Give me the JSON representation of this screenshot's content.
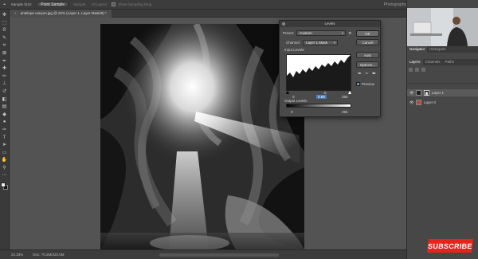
{
  "options_bar": {
    "sample_size_label": "Sample Size:",
    "sample_size_value": "Point Sample",
    "sample_label": "Sample:",
    "sample_value": "All Layers",
    "show_ring_label": "Show Sampling Ring",
    "workspace": "Photography"
  },
  "document_tab": {
    "title": "antelope canyon.jpg @ 22% (Layer 1, Layer Mask/8) *",
    "close": "×"
  },
  "status_bar": {
    "zoom": "22.33%",
    "doc": "Doc: 70.2M/220.0M"
  },
  "levels_dialog": {
    "title": "Levels",
    "preset_label": "Preset:",
    "preset_value": "Custom",
    "channel_label": "Channel:",
    "channel_value": "Layer 1 Mask",
    "input_label": "Input Levels:",
    "input_black": "0",
    "input_mid": "0.69",
    "input_white": "255",
    "output_label": "Output Levels:",
    "output_black": "0",
    "output_white": "255",
    "ok": "OK",
    "cancel": "Cancel",
    "auto": "Auto",
    "options": "Options...",
    "preview": "Preview"
  },
  "right_panel": {
    "tabs_top": [
      "Navigator",
      "Histogram"
    ],
    "tabs_layers": [
      "Layers",
      "Channels",
      "Paths"
    ],
    "layers": [
      {
        "name": "Layer 1",
        "selected": true
      },
      {
        "name": "Layer 0",
        "selected": false
      }
    ]
  },
  "subscribe": "SUBSCRIBE",
  "icons": {
    "tools": [
      "move-icon",
      "marquee-icon",
      "lasso-icon",
      "quick-select-icon",
      "crop-icon",
      "frame-icon",
      "eyedropper-icon",
      "healing-icon",
      "brush-icon",
      "stamp-icon",
      "history-brush-icon",
      "eraser-icon",
      "gradient-icon",
      "blur-icon",
      "dodge-icon",
      "pen-icon",
      "type-icon",
      "path-select-icon",
      "rectangle-icon",
      "hand-icon",
      "zoom-icon",
      "more-icon"
    ]
  },
  "colors": {
    "accent": "#4a7ab8",
    "subscribe_red": "#e8241a",
    "panel": "#474747",
    "canvas_bg": "#535353"
  }
}
